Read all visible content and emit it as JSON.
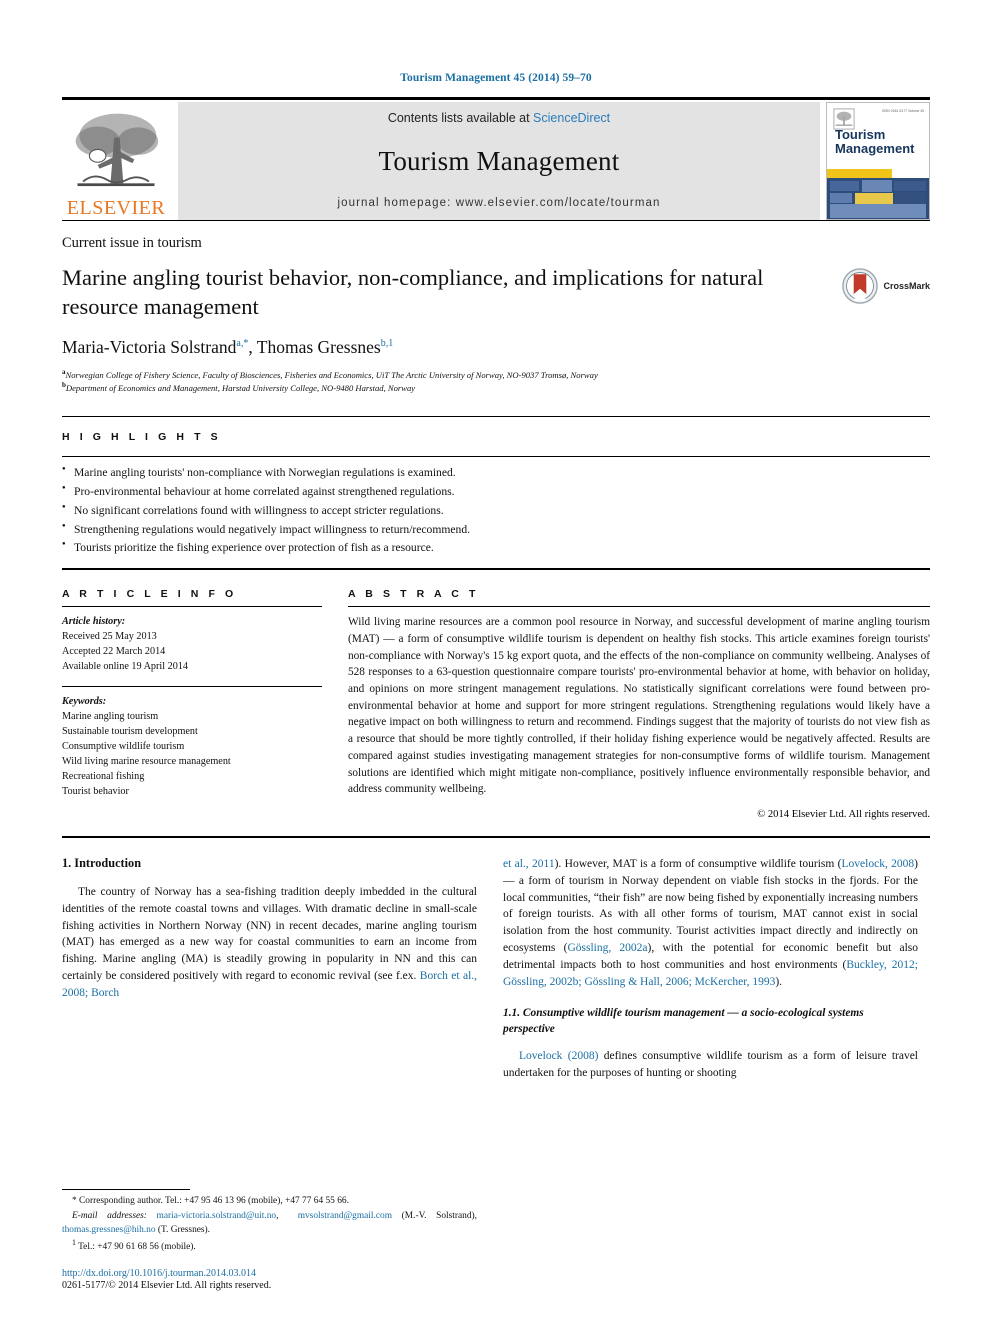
{
  "running_head": "Tourism Management 45 (2014) 59–70",
  "masthead": {
    "contents_prefix": "Contents lists available at ",
    "contents_link": "ScienceDirect",
    "journal_title": "Tourism Management",
    "homepage": "journal homepage: www.elsevier.com/locate/tourman",
    "publisher_logo_text": "ELSEVIER",
    "cover": {
      "line1": "Tourism",
      "line2": "Management",
      "corner_code": "ISSN 0261-5177   Volume 45"
    }
  },
  "article": {
    "section_label": "Current issue in tourism",
    "title": "Marine angling tourist behavior, non-compliance, and implications for natural resource management",
    "crossmark_label": "CrossMark",
    "authors": [
      {
        "name": "Maria-Victoria Solstrand",
        "marks": "a,*"
      },
      {
        "name": "Thomas Gressnes",
        "marks": "b,1"
      }
    ],
    "authors_display": "Maria-Victoria Solstrand, Thomas Gressnes",
    "affiliations": [
      {
        "mark": "a",
        "text": "Norwegian College of Fishery Science, Faculty of Biosciences, Fisheries and Economics, UiT The Arctic University of Norway, NO-9037 Tromsø, Norway"
      },
      {
        "mark": "b",
        "text": "Department of Economics and Management, Harstad University College, NO-9480 Harstad, Norway"
      }
    ]
  },
  "highlights": {
    "heading": "H I G H L I G H T S",
    "items": [
      "Marine angling tourists' non-compliance with Norwegian regulations is examined.",
      "Pro-environmental behaviour at home correlated against strengthened regulations.",
      "No significant correlations found with willingness to accept stricter regulations.",
      "Strengthening regulations would negatively impact willingness to return/recommend.",
      "Tourists prioritize the fishing experience over protection of fish as a resource."
    ]
  },
  "article_info": {
    "heading": "A R T I C L E   I N F O",
    "history_label": "Article history:",
    "history": [
      "Received 25 May 2013",
      "Accepted 22 March 2014",
      "Available online 19 April 2014"
    ],
    "keywords_label": "Keywords:",
    "keywords": [
      "Marine angling tourism",
      "Sustainable tourism development",
      "Consumptive wildlife tourism",
      "Wild living marine resource management",
      "Recreational fishing",
      "Tourist behavior"
    ]
  },
  "abstract": {
    "heading": "A B S T R A C T",
    "text": "Wild living marine resources are a common pool resource in Norway, and successful development of marine angling tourism (MAT) — a form of consumptive wildlife tourism is dependent on healthy fish stocks. This article examines foreign tourists' non-compliance with Norway's 15 kg export quota, and the effects of the non-compliance on community wellbeing. Analyses of 528 responses to a 63-question questionnaire compare tourists' pro-environmental behavior at home, with behavior on holiday, and opinions on more stringent management regulations. No statistically significant correlations were found between pro-environmental behavior at home and support for more stringent regulations. Strengthening regulations would likely have a negative impact on both willingness to return and recommend. Findings suggest that the majority of tourists do not view fish as a resource that should be more tightly controlled, if their holiday fishing experience would be negatively affected. Results are compared against studies investigating management strategies for non-consumptive forms of wildlife tourism. Management solutions are identified which might mitigate non-compliance, positively influence environmentally responsible behavior, and address community wellbeing.",
    "copyright": "© 2014 Elsevier Ltd. All rights reserved."
  },
  "body": {
    "left": {
      "section_number_title": "1.  Introduction",
      "paragraph_1_a": "The country of Norway has a sea-fishing tradition deeply imbedded in the cultural identities of the remote coastal towns and villages. With dramatic decline in small-scale fishing activities in Northern Norway (NN) in recent decades, marine angling tourism (MAT) has emerged as a new way for coastal communities to earn an income from fishing. Marine angling (MA) is steadily growing in popularity in NN and this can certainly be considered positively with regard to economic revival (see f.ex. ",
      "paragraph_1_cite": "Borch et al., 2008; Borch"
    },
    "right": {
      "paragraph_1_cite_cont": "et al., 2011",
      "paragraph_1_b": "). However, MAT is a form of consumptive wildlife tourism (",
      "cite_lovelock": "Lovelock, 2008",
      "paragraph_1_c": ") — a form of tourism in Norway dependent on viable fish stocks in the fjords. For the local communities, “their fish” are now being fished by exponentially increasing numbers of foreign tourists. As with all other forms of tourism, MAT cannot exist in social isolation from the host community. Tourist activities impact directly and indirectly on ecosystems (",
      "cite_gossling": "Gössling, 2002a",
      "paragraph_1_d": "), with the potential for economic benefit but also detrimental impacts both to host communities and host environments (",
      "cite_buckley": "Buckley, 2012; Gössling, 2002b; Gössling & Hall, 2006; McKercher, 1993",
      "paragraph_1_e": ").",
      "subsection_title": "1.1.  Consumptive wildlife tourism management — a socio-ecological systems perspective",
      "cite_lovelock2": "Lovelock (2008)",
      "paragraph_2": " defines consumptive wildlife tourism as a form of leisure travel undertaken for the purposes of hunting or shooting"
    }
  },
  "footnotes": {
    "corresponding": "* Corresponding author. Tel.: +47 95 46 13 96 (mobile), +47 77 64 55 66.",
    "email_label": "E-mail addresses:",
    "email_1": "maria-victoria.solstrand@uit.no",
    "email_2": "mvsolstrand@gmail.com",
    "email_1_owner": "(M.-V. Solstrand),",
    "email_3": "thomas.gressnes@hih.no",
    "email_3_owner": "(T. Gressnes).",
    "tel_note": "Tel.: +47 90 61 68 56 (mobile).",
    "tel_mark": "1",
    "doi": "http://dx.doi.org/10.1016/j.tourman.2014.03.014",
    "issn_line": "0261-5177/© 2014 Elsevier Ltd. All rights reserved."
  },
  "colors": {
    "link": "#1a6fa3",
    "elsevier_orange": "#E87722",
    "masthead_bg": "#e3e3e3",
    "cover_blue": "#16365c"
  }
}
